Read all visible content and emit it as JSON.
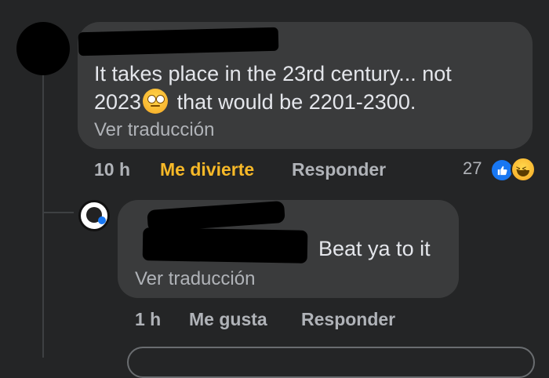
{
  "comments": [
    {
      "text_line1": "It takes place in the 23rd century... not",
      "text_line2_before": "2023",
      "emoji": "rolling-eyes-emoji",
      "text_line2_after": "that would be 2201-2300.",
      "translate": "Ver traducción",
      "time": "10 h",
      "like_label": "Me divierte",
      "reply_label": "Responder",
      "reaction_count": "27",
      "reactions": [
        "like-reaction-icon",
        "haha-reaction-icon"
      ]
    },
    {
      "text": "Beat ya to it",
      "translate": "Ver traducción",
      "time": "1 h",
      "like_label": "Me gusta",
      "reply_label": "Responder"
    }
  ],
  "colors": {
    "background": "#242526",
    "bubble": "#3a3b3c",
    "secondary_text": "#b0b3b8",
    "active_reaction": "#f7b928",
    "facebook_blue": "#1877f2"
  }
}
